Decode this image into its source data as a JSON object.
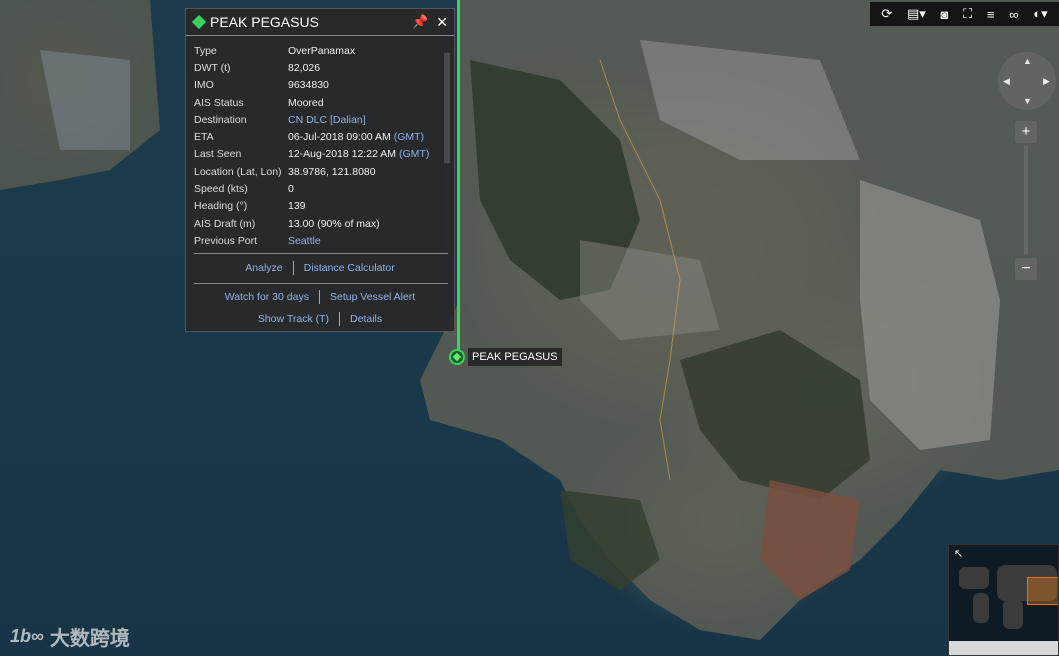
{
  "vessel": {
    "name": "PEAK PEGASUS",
    "fields": [
      {
        "label": "Type",
        "value": "OverPanamax",
        "suffix": ""
      },
      {
        "label": "DWT (t)",
        "value": "82,026",
        "suffix": ""
      },
      {
        "label": "IMO",
        "value": "9634830",
        "suffix": ""
      },
      {
        "label": "AIS Status",
        "value": "Moored",
        "suffix": ""
      },
      {
        "label": "Destination",
        "value": "CN DLC [Dalian]",
        "suffix": ""
      },
      {
        "label": "ETA",
        "value": "06-Jul-2018 09:00 AM",
        "suffix": "(GMT)"
      },
      {
        "label": "Last Seen",
        "value": "12-Aug-2018 12:22 AM",
        "suffix": "(GMT)"
      },
      {
        "label": "Location (Lat, Lon)",
        "value": "38.9786, 121.8080",
        "suffix": ""
      },
      {
        "label": "Speed (kts)",
        "value": "0",
        "suffix": ""
      },
      {
        "label": "Heading (°)",
        "value": "139",
        "suffix": ""
      },
      {
        "label": "AIS Draft (m)",
        "value": "13.00  (90% of max)",
        "suffix": ""
      },
      {
        "label": "Previous Port",
        "value": "Seattle",
        "suffix": ""
      }
    ]
  },
  "actions": {
    "analyze": "Analyze",
    "distance_calculator": "Distance Calculator",
    "watch": "Watch for 30 days",
    "setup_alert": "Setup Vessel Alert",
    "show_track": "Show Track (T)",
    "details": "Details"
  },
  "map_label": "PEAK PEGASUS",
  "toolbar": {
    "refresh": "⟳",
    "layers": "▤▾",
    "camera": "◙",
    "fullscreen": "⛶",
    "list": "≡",
    "loop": "∞",
    "globe": "◐▾"
  },
  "nav": {
    "up": "▲",
    "left": "◀",
    "right": "▶",
    "down": "▼",
    "zoom_in": "+",
    "zoom_out": "−"
  },
  "watermark": {
    "logo": "1b∞",
    "text": "大数跨境"
  },
  "colors": {
    "track": "#3bd35a",
    "link": "#8fb4e8",
    "minimap_frame": "#e07a16"
  }
}
